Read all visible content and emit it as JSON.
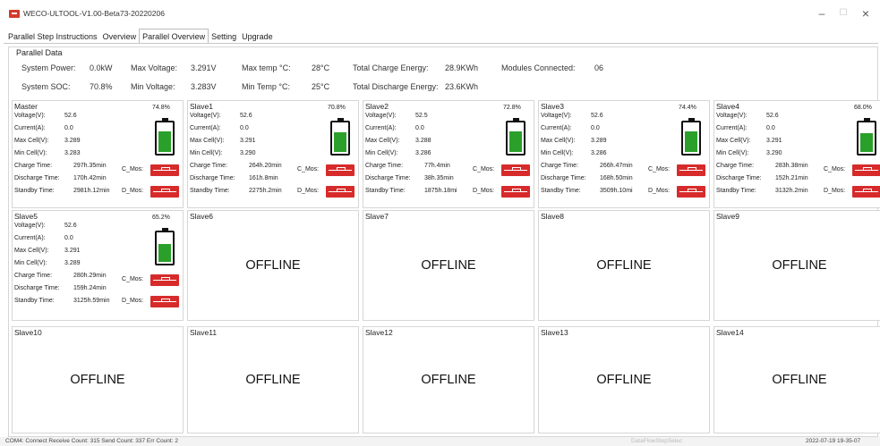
{
  "window": {
    "title": "WECO-ULTOOL-V1.00-Beta73-20220206",
    "icon": "app-logo-icon",
    "controls": {
      "minimize": "–",
      "maximize": "☐",
      "close": "×"
    }
  },
  "tabs": [
    {
      "label": "Parallel Step Instructions",
      "active": false
    },
    {
      "label": "Overview",
      "active": false
    },
    {
      "label": "Parallel Overview",
      "active": true
    },
    {
      "label": "Setting",
      "active": false
    },
    {
      "label": "Upgrade",
      "active": false
    }
  ],
  "parallel_data": {
    "title": "Parallel Data",
    "system_power_label": "System Power:",
    "system_power_value": "0.0kW",
    "system_soc_label": "System SOC:",
    "system_soc_value": "70.8%",
    "max_voltage_label": "Max Voltage:",
    "max_voltage_value": "3.291V",
    "min_voltage_label": "Min Voltage:",
    "min_voltage_value": "3.283V",
    "max_temp_label": "Max temp °C:",
    "max_temp_value": "28°C",
    "min_temp_label": "Min Temp °C:",
    "min_temp_value": "25°C",
    "total_charge_label": "Total Charge Energy:",
    "total_charge_value": "28.9KWh",
    "total_discharge_label": "Total Discharge Energy:",
    "total_discharge_value": "23.6KWh",
    "modules_connected_label": "Modules Connected:",
    "modules_connected_value": "06"
  },
  "field_labels": {
    "voltage": "Voltage(V):",
    "current": "Current(A):",
    "max_cell": "Max Cell(V):",
    "min_cell": "Min Cell(V):",
    "charge_time": "Charge Time:",
    "discharge_time": "Discharge Time:",
    "standby_time": "Standby Time:",
    "c_mos": "C_Mos:",
    "d_mos": "D_Mos:"
  },
  "modules": [
    {
      "name": "Master",
      "online": true,
      "soc_pct": "74.8%",
      "soc": 0.748,
      "voltage": "52.6",
      "current": "0.0",
      "max_cell": "3.289",
      "min_cell": "3.283",
      "charge_time": "297h.35min",
      "discharge_time": "170h.42min",
      "standby_time": "2981h.12min"
    },
    {
      "name": "Slave1",
      "online": true,
      "soc_pct": "70.8%",
      "soc": 0.708,
      "voltage": "52.6",
      "current": "0.0",
      "max_cell": "3.291",
      "min_cell": "3.290",
      "charge_time": "264h.20min",
      "discharge_time": "161h.8min",
      "standby_time": "2275h.2min"
    },
    {
      "name": "Slave2",
      "online": true,
      "soc_pct": "72.8%",
      "soc": 0.728,
      "voltage": "52.5",
      "current": "0.0",
      "max_cell": "3.288",
      "min_cell": "3.286",
      "charge_time": "77h.4min",
      "discharge_time": "38h.35min",
      "standby_time": "1875h.18mi"
    },
    {
      "name": "Slave3",
      "online": true,
      "soc_pct": "74.4%",
      "soc": 0.744,
      "voltage": "52.6",
      "current": "0.0",
      "max_cell": "3.289",
      "min_cell": "3.286",
      "charge_time": "266h.47min",
      "discharge_time": "168h.50min",
      "standby_time": "3509h.10mi"
    },
    {
      "name": "Slave4",
      "online": true,
      "soc_pct": "68.0%",
      "soc": 0.68,
      "voltage": "52.6",
      "current": "0.0",
      "max_cell": "3.291",
      "min_cell": "3.290",
      "charge_time": "283h.38min",
      "discharge_time": "152h.21min",
      "standby_time": "3132h.2min"
    },
    {
      "name": "Slave5",
      "online": true,
      "soc_pct": "65.2%",
      "soc": 0.652,
      "voltage": "52.6",
      "current": "0.0",
      "max_cell": "3.291",
      "min_cell": "3.289",
      "charge_time": "280h.29min",
      "discharge_time": "159h.24min",
      "standby_time": "3125h.59min"
    },
    {
      "name": "Slave6",
      "online": false,
      "status": "OFFLINE"
    },
    {
      "name": "Slave7",
      "online": false,
      "status": "OFFLINE"
    },
    {
      "name": "Slave8",
      "online": false,
      "status": "OFFLINE"
    },
    {
      "name": "Slave9",
      "online": false,
      "status": "OFFLINE"
    },
    {
      "name": "Slave10",
      "online": false,
      "status": "OFFLINE"
    },
    {
      "name": "Slave11",
      "online": false,
      "status": "OFFLINE"
    },
    {
      "name": "Slave12",
      "online": false,
      "status": "OFFLINE"
    },
    {
      "name": "Slave13",
      "online": false,
      "status": "OFFLINE"
    },
    {
      "name": "Slave14",
      "online": false,
      "status": "OFFLINE"
    }
  ],
  "status_bar": {
    "left": "COM4: Connect  Receive Count: 315  Send Count: 337  Err Count: 2",
    "middle": "DataFlowStepSelec",
    "right": "2022-07-19 19-35-07"
  },
  "colors": {
    "battery_fill": "#2aa02a",
    "mos_icon": "#d72b2b",
    "app_icon": "#d43a2a"
  }
}
